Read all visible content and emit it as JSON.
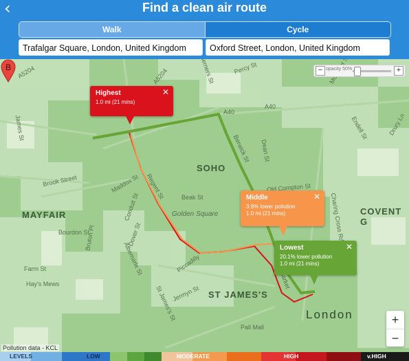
{
  "header": {
    "back_icon": "chevron-left-icon",
    "title": "Find a clean air route",
    "modes": [
      "Walk",
      "Cycle"
    ],
    "selected_mode": "Walk",
    "from": "Trafalgar Square, London, United Kingdom",
    "to": "Oxford Street, London, United Kingdom"
  },
  "map": {
    "areas": {
      "soho": "SOHO",
      "mayfair": "MAYFAIR",
      "st_james": "ST JAMES'S",
      "covent": "COVENT G",
      "london": "London"
    },
    "streets": [
      "A5204",
      "Berners St",
      "A40",
      "A40",
      "Dean St",
      "Berwick St",
      "Brook Street",
      "Maddox St",
      "Regent St",
      "Beak St",
      "Golden Square",
      "Conduit St",
      "Piccadilly",
      "Jermyn St",
      "St James's St",
      "Pall Mall",
      "Haymarket",
      "Albemarle St",
      "Dover St",
      "Bruton Pl",
      "Bourdon St",
      "Farm St",
      "Hay's Mews",
      "Old Compton St",
      "Charing Cross Rd",
      "Endell St",
      "Drury Ln",
      "Mortimer St",
      "Wardour St",
      "James St",
      "Oxford St",
      "Bond St",
      "A5204",
      "Percy St",
      "Shaftesbury Ave"
    ],
    "opacity_label": "opacity 50%",
    "opacity_value": 0.5,
    "marker_label": "B",
    "attribution": "Pollution data - KCL"
  },
  "routes": [
    {
      "name": "Highest",
      "line1": "1.0 mi (21 mins)",
      "line2": "",
      "color": "#d9121b"
    },
    {
      "name": "Middle",
      "line1": "3.9% lower pollution",
      "line2": "1.0 mi (21 mins)",
      "color": "#f7954b"
    },
    {
      "name": "Lowest",
      "line1": "20.1% lower pollution",
      "line2": "1.0 mi (21 mins)",
      "color": "#68a537"
    }
  ],
  "zoom": {
    "in": "+",
    "out": "−"
  },
  "legend": {
    "labels": [
      "LEVELS",
      "LOW",
      "MODERATE",
      "HIGH",
      "v.HIGH"
    ],
    "colors": [
      "#a9cfee",
      "#72b0e4",
      "#2e76c7",
      "#8cc56e",
      "#5ba63e",
      "#3f8a2c",
      "#f2c49c",
      "#f39a4f",
      "#ea6e1b",
      "#e53333",
      "#c4161c",
      "#8e0e12",
      "#1a1a1a"
    ]
  }
}
